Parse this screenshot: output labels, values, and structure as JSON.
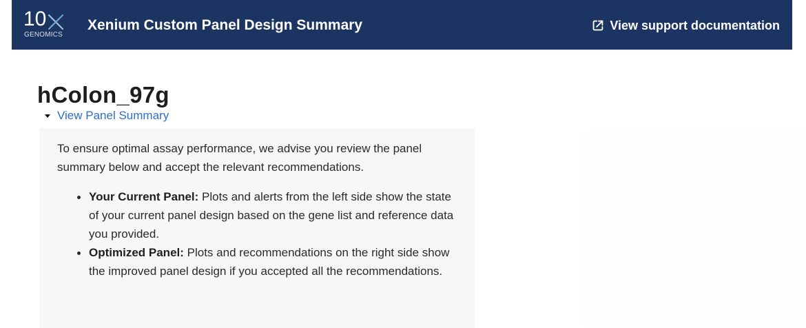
{
  "header": {
    "logo": {
      "main": "10",
      "sub": "GENOMICS"
    },
    "title": "Xenium Custom Panel Design Summary",
    "support_link": {
      "label": "View support documentation",
      "icon": "external-link-icon"
    },
    "colors": {
      "background": "#1c3461",
      "text": "#ffffff",
      "logo_accent": "#9ec5d8"
    }
  },
  "main": {
    "title": "hColon_97g",
    "summary_toggle": {
      "label": "View Panel Summary",
      "icon": "caret-down-icon",
      "color": "#2f6ec7"
    },
    "summary_card": {
      "intro": "To ensure optimal assay performance, we advise you review the panel summary below and accept the relevant recommendations.",
      "items": [
        {
          "label": "Your Current Panel:",
          "text": "Plots and alerts from the left side show the state of your current panel design based on the gene list and reference data you provided."
        },
        {
          "label": "Optimized Panel:",
          "text": "Plots and recommendations on the right side show the improved panel design if you accepted all the recommendations."
        }
      ],
      "background": "#f7f7f9"
    }
  }
}
